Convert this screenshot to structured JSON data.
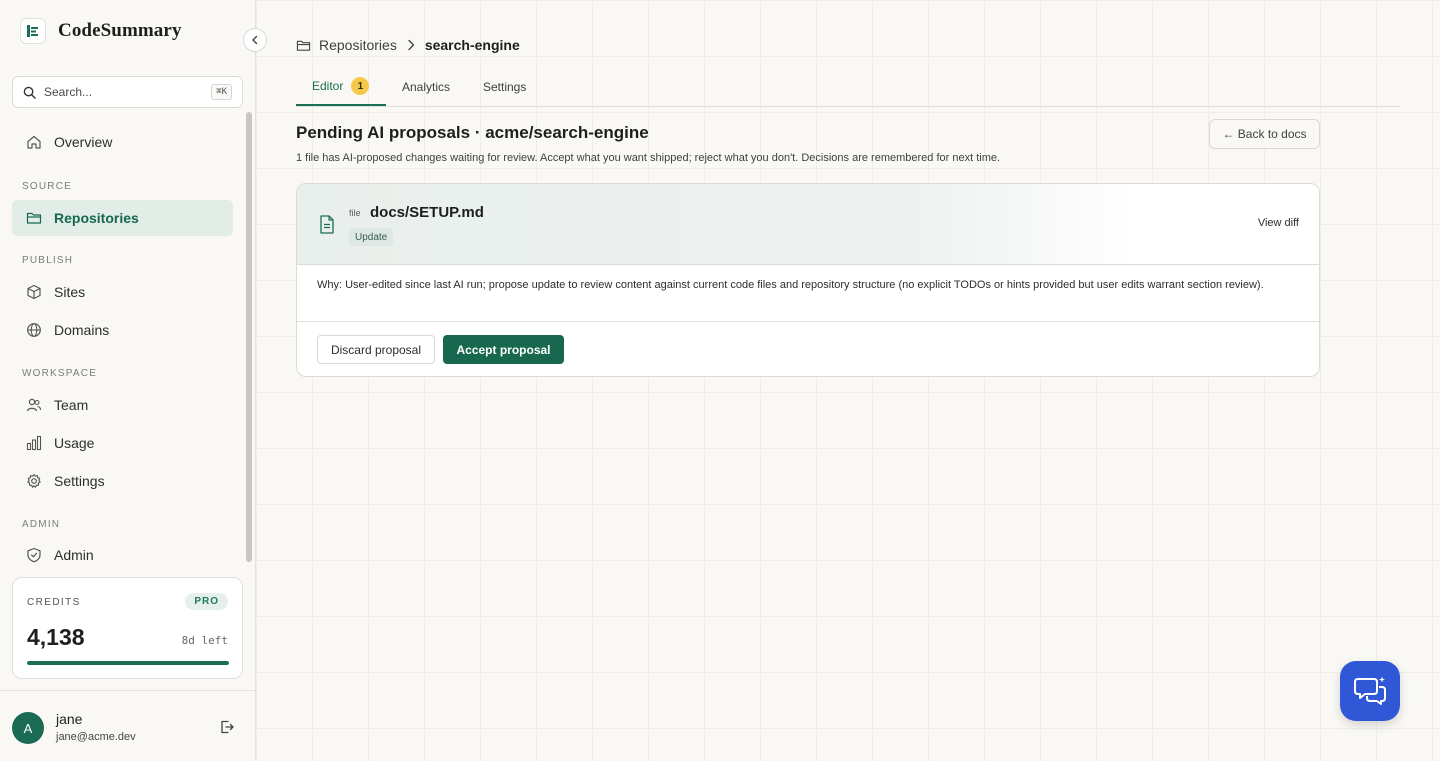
{
  "app": {
    "name": "CodeSummary"
  },
  "search": {
    "placeholder": "Search...",
    "shortcut": "⌘K"
  },
  "sidebar": {
    "sections": {
      "source": "SOURCE",
      "publish": "PUBLISH",
      "workspace": "WORKSPACE",
      "admin": "ADMIN"
    },
    "items": [
      {
        "label": "Overview",
        "icon": "home-icon",
        "active": false
      },
      {
        "label": "Repositories",
        "icon": "folder-icon",
        "active": true
      },
      {
        "label": "Sites",
        "icon": "cube-icon",
        "active": false
      },
      {
        "label": "Domains",
        "icon": "globe-icon",
        "active": false
      },
      {
        "label": "Team",
        "icon": "users-icon",
        "active": false
      },
      {
        "label": "Usage",
        "icon": "bar-chart-icon",
        "active": false
      },
      {
        "label": "Settings",
        "icon": "gear-icon",
        "active": false
      },
      {
        "label": "Admin",
        "icon": "shield-icon",
        "active": false
      }
    ]
  },
  "credits": {
    "label": "CREDITS",
    "plan": "PRO",
    "value": "4,138",
    "remaining": "8d left",
    "progress": 1.0
  },
  "user": {
    "initial": "A",
    "name": "jane",
    "email": "jane@acme.dev"
  },
  "breadcrumb": {
    "parent": "Repositories",
    "current": "search-engine"
  },
  "tabs": [
    {
      "label": "Editor",
      "badge": "1",
      "active": true
    },
    {
      "label": "Analytics",
      "active": false
    },
    {
      "label": "Settings",
      "active": false
    }
  ],
  "page": {
    "title": "Pending AI proposals · acme/search-engine",
    "subtitle": "1 file has AI-proposed changes waiting for review. Accept what you want shipped; reject what you don't. Decisions are remembered for next time.",
    "back_label": "← Back to docs"
  },
  "proposal": {
    "kind": "file",
    "path": "docs/SETUP.md",
    "change_type": "Update",
    "view_diff_label": "View diff",
    "why": "Why: User-edited since last AI run; propose update to review content against current code files and repository structure (no explicit TODOs or hints provided but user edits warrant section review).",
    "discard_label": "Discard proposal",
    "accept_label": "Accept proposal"
  },
  "colors": {
    "accent": "#1a6e55",
    "badge": "#f5c84b",
    "chat": "#2f57d6"
  }
}
